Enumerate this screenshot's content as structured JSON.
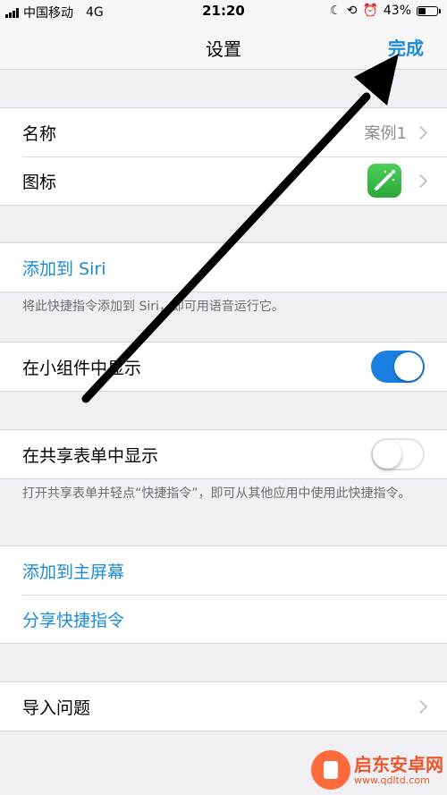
{
  "status_bar": {
    "carrier": "中国移动",
    "network": "4G",
    "time": "21:20",
    "battery_percent": "43%",
    "battery_level": 0.43
  },
  "nav": {
    "title": "设置",
    "done_label": "完成"
  },
  "info_group": {
    "name_label": "名称",
    "name_value": "案例1",
    "icon_label": "图标"
  },
  "siri_group": {
    "add_to_siri_label": "添加到 Siri",
    "note": "将此快捷指令添加到 Siri，即可用语音运行它。"
  },
  "widget_group": {
    "label": "在小组件中显示",
    "enabled": true
  },
  "share_group": {
    "label": "在共享表单中显示",
    "enabled": false,
    "note": "打开共享表单并轻点“快捷指令”，即可从其他应用中使用此快捷指令。"
  },
  "action_group": {
    "add_home_label": "添加到主屏幕",
    "share_label": "分享快捷指令"
  },
  "import_group": {
    "label": "导入问题"
  },
  "watermark": {
    "name": "启东安卓网",
    "url": "www.qdltd.com"
  },
  "colors": {
    "accent": "#1a8ad9",
    "toggle_on": "#1a7fe0",
    "background": "#efeff4"
  }
}
